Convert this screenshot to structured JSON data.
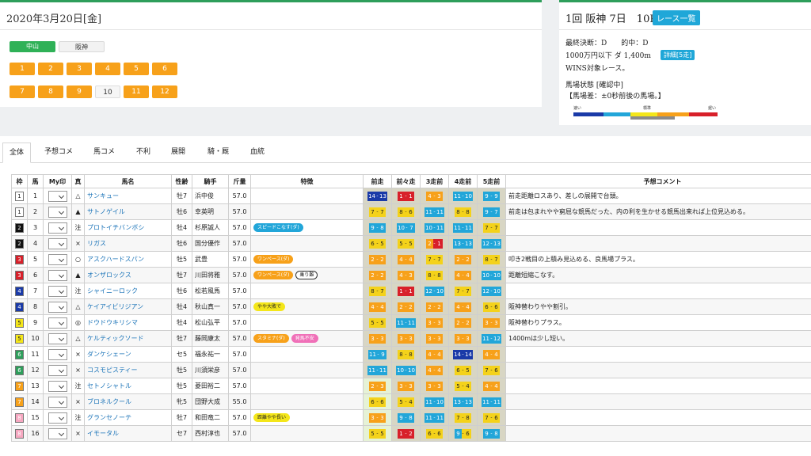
{
  "left": {
    "date_title": "2020年3月20日[金]",
    "venues": [
      {
        "label": "中山",
        "active": true
      },
      {
        "label": "阪神",
        "active": false
      }
    ],
    "races_row1": [
      "1",
      "2",
      "3",
      "4",
      "5",
      "6"
    ],
    "races_row2": [
      "7",
      "8",
      "9",
      "10",
      "11",
      "12"
    ],
    "current_race": "10"
  },
  "right": {
    "title": "1回 阪神 7日　10R",
    "list_button": "レース一覧",
    "line1": "最終決断：D　　的中：D",
    "line2": "1000万円以下 ダ 1,400m",
    "detail_button": "詳細[5走]",
    "line3": "WINS対象レース。",
    "track_label": "馬場状態 [確認中]",
    "track_note": "【馬場差：±0秒前後の馬場。】",
    "cond_fast": "速い",
    "cond_std": "標準",
    "cond_slow": "遅い"
  },
  "tabs": [
    "全体",
    "予想コメ",
    "馬コメ",
    "不利",
    "展開",
    "騎・厩",
    "血統"
  ],
  "table": {
    "headers": [
      "枠",
      "馬",
      "My印",
      "真",
      "馬名",
      "性齢",
      "騎手",
      "斤量",
      "特徴",
      "前走",
      "前々走",
      "3走前",
      "4走前",
      "5走前",
      "予想コメント"
    ],
    "rows": [
      {
        "waku": "1",
        "num": "1",
        "mark": "△",
        "name": "サンキュー",
        "sex": "牡7",
        "jockey": "浜中俊",
        "kin": "57.0",
        "tags": [],
        "past": [
          [
            "14",
            "13",
            "#1a3aa8",
            "#1a3aa8"
          ],
          [
            "1",
            "1",
            "#d8202a",
            "#d8202a"
          ],
          [
            "4",
            "3",
            "#f7a11a",
            "#f7a11a"
          ],
          [
            "11",
            "10",
            "#22a6d9",
            "#22a6d9"
          ],
          [
            "9",
            "9",
            "#22a6d9",
            "#22a6d9"
          ]
        ],
        "comment": "前走距離ロスあり、差しの展開で台頭。"
      },
      {
        "waku": "1",
        "num": "2",
        "mark": "▲",
        "name": "サトノゲイル",
        "sex": "牡6",
        "jockey": "幸英明",
        "kin": "57.0",
        "tags": [],
        "past": [
          [
            "7",
            "7",
            "#f4d21a",
            "#f4d21a"
          ],
          [
            "8",
            "6",
            "#f4d21a",
            "#f4d21a"
          ],
          [
            "11",
            "11",
            "#22a6d9",
            "#22a6d9"
          ],
          [
            "8",
            "8",
            "#f4d21a",
            "#f4d21a"
          ],
          [
            "9",
            "7",
            "#22a6d9",
            "#22a6d9"
          ]
        ],
        "comment": "前走は包まれやや窮屈な競馬だった、内の利を生かせる競馬出来れば上位見込める。"
      },
      {
        "waku": "2",
        "num": "3",
        "mark": "注",
        "name": "プロトイチバンボシ",
        "sex": "牡4",
        "jockey": "杉原誠人",
        "kin": "57.0",
        "tags": [
          {
            "t": "スピードこなす(ダ)",
            "c": "#22a6d9"
          }
        ],
        "past": [
          [
            "9",
            "8",
            "#22a6d9",
            "#22a6d9"
          ],
          [
            "10",
            "7",
            "#22a6d9",
            "#22a6d9"
          ],
          [
            "10",
            "11",
            "#22a6d9",
            "#22a6d9"
          ],
          [
            "11",
            "11",
            "#22a6d9",
            "#22a6d9"
          ],
          [
            "7",
            "7",
            "#f4d21a",
            "#f4d21a"
          ]
        ],
        "comment": ""
      },
      {
        "waku": "2",
        "num": "4",
        "mark": "×",
        "name": "リガス",
        "sex": "牡6",
        "jockey": "国分優作",
        "kin": "57.0",
        "tags": [],
        "past": [
          [
            "6",
            "5",
            "#f4d21a",
            "#f4d21a"
          ],
          [
            "5",
            "5",
            "#f4d21a",
            "#f4d21a"
          ],
          [
            "2",
            "1",
            "#f7a11a",
            "#d8202a"
          ],
          [
            "13",
            "13",
            "#22a6d9",
            "#22a6d9"
          ],
          [
            "12",
            "13",
            "#22a6d9",
            "#22a6d9"
          ]
        ],
        "comment": ""
      },
      {
        "waku": "3",
        "num": "5",
        "mark": "○",
        "name": "アスクハードスパン",
        "sex": "牡5",
        "jockey": "武豊",
        "kin": "57.0",
        "tags": [
          {
            "t": "ワンペース(ダ)",
            "c": "#f7a11a"
          }
        ],
        "past": [
          [
            "2",
            "2",
            "#f7a11a",
            "#f7a11a"
          ],
          [
            "4",
            "4",
            "#f7a11a",
            "#f7a11a"
          ],
          [
            "7",
            "7",
            "#f4d21a",
            "#f4d21a"
          ],
          [
            "2",
            "2",
            "#f7a11a",
            "#f7a11a"
          ],
          [
            "8",
            "7",
            "#f4d21a",
            "#f4d21a"
          ]
        ],
        "comment": "叩き2戦目の上積み見込める、良馬場プラス。"
      },
      {
        "waku": "3",
        "num": "6",
        "mark": "▲",
        "name": "オンザロックス",
        "sex": "牡7",
        "jockey": "川田将雅",
        "kin": "57.0",
        "tags": [
          {
            "t": "ワンペース(ダ)",
            "c": "#f7a11a"
          },
          {
            "t": "乗り難",
            "c": "#ffffff"
          }
        ],
        "past": [
          [
            "2",
            "2",
            "#f7a11a",
            "#f7a11a"
          ],
          [
            "4",
            "3",
            "#f7a11a",
            "#f7a11a"
          ],
          [
            "8",
            "8",
            "#f4d21a",
            "#f4d21a"
          ],
          [
            "4",
            "4",
            "#f7a11a",
            "#f7a11a"
          ],
          [
            "10",
            "10",
            "#22a6d9",
            "#22a6d9"
          ]
        ],
        "comment": "距離短縮こなす。"
      },
      {
        "waku": "4",
        "num": "7",
        "mark": "注",
        "name": "シャイニーロック",
        "sex": "牡6",
        "jockey": "松若風馬",
        "kin": "57.0",
        "tags": [],
        "past": [
          [
            "8",
            "7",
            "#f4d21a",
            "#f4d21a"
          ],
          [
            "1",
            "1",
            "#d8202a",
            "#d8202a"
          ],
          [
            "12",
            "10",
            "#22a6d9",
            "#22a6d9"
          ],
          [
            "7",
            "7",
            "#f4d21a",
            "#f4d21a"
          ],
          [
            "12",
            "10",
            "#22a6d9",
            "#22a6d9"
          ]
        ],
        "comment": ""
      },
      {
        "waku": "4",
        "num": "8",
        "mark": "△",
        "name": "ケイアイビリジアン",
        "sex": "牡4",
        "jockey": "秋山真一",
        "kin": "57.0",
        "tags": [
          {
            "t": "やや大敗で",
            "c": "#f4e61a"
          }
        ],
        "past": [
          [
            "4",
            "4",
            "#f7a11a",
            "#f7a11a"
          ],
          [
            "2",
            "2",
            "#f7a11a",
            "#f7a11a"
          ],
          [
            "2",
            "2",
            "#f7a11a",
            "#f7a11a"
          ],
          [
            "4",
            "4",
            "#f7a11a",
            "#f7a11a"
          ],
          [
            "6",
            "6",
            "#f4d21a",
            "#f4d21a"
          ]
        ],
        "comment": "阪神替わりやや割引。"
      },
      {
        "waku": "5",
        "num": "9",
        "mark": "◎",
        "name": "ドウドウキリシマ",
        "sex": "牡4",
        "jockey": "松山弘平",
        "kin": "57.0",
        "tags": [],
        "past": [
          [
            "5",
            "5",
            "#f4d21a",
            "#f4d21a"
          ],
          [
            "11",
            "11",
            "#22a6d9",
            "#22a6d9"
          ],
          [
            "3",
            "3",
            "#f7a11a",
            "#f7a11a"
          ],
          [
            "2",
            "2",
            "#f7a11a",
            "#f7a11a"
          ],
          [
            "3",
            "3",
            "#f7a11a",
            "#f7a11a"
          ]
        ],
        "comment": "阪神替わりプラス。"
      },
      {
        "waku": "5",
        "num": "10",
        "mark": "△",
        "name": "ケルティックソード",
        "sex": "牡7",
        "jockey": "藤岡康太",
        "kin": "57.0",
        "tags": [
          {
            "t": "スタミナ(ダ)",
            "c": "#f7a11a"
          },
          {
            "t": "発馬不安",
            "c": "#f070b8"
          }
        ],
        "past": [
          [
            "3",
            "3",
            "#f7a11a",
            "#f7a11a"
          ],
          [
            "3",
            "3",
            "#f7a11a",
            "#f7a11a"
          ],
          [
            "3",
            "3",
            "#f7a11a",
            "#f7a11a"
          ],
          [
            "3",
            "3",
            "#f7a11a",
            "#f7a11a"
          ],
          [
            "11",
            "12",
            "#22a6d9",
            "#22a6d9"
          ]
        ],
        "comment": "1400mは少し短い。"
      },
      {
        "waku": "6",
        "num": "11",
        "mark": "×",
        "name": "ダンケシェーン",
        "sex": "セ5",
        "jockey": "福永祐一",
        "kin": "57.0",
        "tags": [],
        "past": [
          [
            "11",
            "9",
            "#22a6d9",
            "#22a6d9"
          ],
          [
            "8",
            "8",
            "#f4d21a",
            "#f4d21a"
          ],
          [
            "4",
            "4",
            "#f7a11a",
            "#f7a11a"
          ],
          [
            "14",
            "14",
            "#1a3aa8",
            "#1a3aa8"
          ],
          [
            "4",
            "4",
            "#f7a11a",
            "#f7a11a"
          ]
        ],
        "comment": ""
      },
      {
        "waku": "6",
        "num": "12",
        "mark": "×",
        "name": "コスモピスティー",
        "sex": "牡5",
        "jockey": "川須栄彦",
        "kin": "57.0",
        "tags": [],
        "past": [
          [
            "11",
            "11",
            "#22a6d9",
            "#22a6d9"
          ],
          [
            "10",
            "10",
            "#22a6d9",
            "#22a6d9"
          ],
          [
            "4",
            "4",
            "#f7a11a",
            "#f7a11a"
          ],
          [
            "6",
            "5",
            "#f4d21a",
            "#f4d21a"
          ],
          [
            "7",
            "6",
            "#f4d21a",
            "#f4d21a"
          ]
        ],
        "comment": ""
      },
      {
        "waku": "7",
        "num": "13",
        "mark": "注",
        "name": "セトノシャトル",
        "sex": "牡5",
        "jockey": "菱田裕二",
        "kin": "57.0",
        "tags": [],
        "past": [
          [
            "2",
            "3",
            "#f7a11a",
            "#f7a11a"
          ],
          [
            "3",
            "3",
            "#f7a11a",
            "#f7a11a"
          ],
          [
            "3",
            "3",
            "#f7a11a",
            "#f7a11a"
          ],
          [
            "5",
            "4",
            "#f4d21a",
            "#f4d21a"
          ],
          [
            "4",
            "4",
            "#f7a11a",
            "#f7a11a"
          ]
        ],
        "comment": ""
      },
      {
        "waku": "7",
        "num": "14",
        "mark": "×",
        "name": "ブロネルクール",
        "sex": "牝5",
        "jockey": "団野大成",
        "kin": "55.0",
        "tags": [],
        "past": [
          [
            "6",
            "6",
            "#f4d21a",
            "#f4d21a"
          ],
          [
            "5",
            "4",
            "#f4d21a",
            "#f4d21a"
          ],
          [
            "11",
            "10",
            "#22a6d9",
            "#22a6d9"
          ],
          [
            "13",
            "13",
            "#22a6d9",
            "#22a6d9"
          ],
          [
            "11",
            "11",
            "#22a6d9",
            "#22a6d9"
          ]
        ],
        "comment": ""
      },
      {
        "waku": "8",
        "num": "15",
        "mark": "注",
        "name": "グランセノーテ",
        "sex": "牡7",
        "jockey": "和田竜二",
        "kin": "57.0",
        "tags": [
          {
            "t": "距離やや長い",
            "c": "#f4e61a"
          }
        ],
        "past": [
          [
            "3",
            "3",
            "#f7a11a",
            "#f7a11a"
          ],
          [
            "9",
            "8",
            "#22a6d9",
            "#22a6d9"
          ],
          [
            "11",
            "11",
            "#22a6d9",
            "#22a6d9"
          ],
          [
            "7",
            "8",
            "#f4d21a",
            "#f4d21a"
          ],
          [
            "7",
            "6",
            "#f4d21a",
            "#f4d21a"
          ]
        ],
        "comment": ""
      },
      {
        "waku": "8",
        "num": "16",
        "mark": "×",
        "name": "イモータル",
        "sex": "セ7",
        "jockey": "西村淳也",
        "kin": "57.0",
        "tags": [],
        "past": [
          [
            "5",
            "5",
            "#f4d21a",
            "#f4d21a"
          ],
          [
            "1",
            "2",
            "#d8202a",
            "#d8202a"
          ],
          [
            "6",
            "6",
            "#f4d21a",
            "#f4d21a"
          ],
          [
            "9",
            "6",
            "#22a6d9",
            "#f4d21a"
          ],
          [
            "9",
            "8",
            "#22a6d9",
            "#22a6d9"
          ]
        ],
        "comment": ""
      }
    ]
  },
  "colors": {
    "accent_green": "#2e9e5b",
    "race_orange": "#f7a11a",
    "info_blue": "#1fa7d8"
  }
}
